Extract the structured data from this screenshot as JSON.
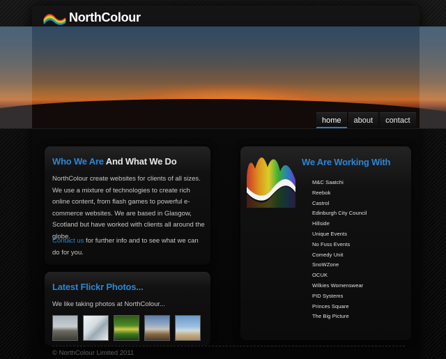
{
  "header": {
    "logo_text": "NorthColour",
    "logo_icon": "rainbow-wave-icon"
  },
  "nav": {
    "tabs": [
      {
        "label": "home",
        "active": true
      },
      {
        "label": "about",
        "active": false
      },
      {
        "label": "contact",
        "active": false
      }
    ]
  },
  "who": {
    "heading_blue": "Who We Are",
    "heading_white": "And What We Do",
    "paragraph": "NorthColour create websites for clients of all sizes. We use a mixture of technologies to create rich online content, from flash games to powerful e-commerce websites. We are based in Glasgow, Scotland but have worked with clients all around the globe.",
    "contact_link": "Contact us",
    "contact_rest": " for further info and to see what we can do for you."
  },
  "flickr": {
    "heading": "Latest Flickr Photos...",
    "text": "We like taking photos at NorthColour..."
  },
  "working": {
    "heading": "We Are Working With",
    "icon": "rainbow-wave-icon",
    "clients": [
      "M&C Saatchi",
      "Reebok",
      "Castrol",
      "Edinburgh City Council",
      "Hillside",
      "Unique Events",
      "No Fuss Events",
      "Comedy Unit",
      "SnoWZone",
      "OCUK",
      "Wilkies Womenswear",
      "PID Systems",
      "Princes Square",
      "The Big Picture"
    ]
  },
  "footer": {
    "copyright": "© NorthColour Limited 2011"
  },
  "colors": {
    "accent": "#2c86d6",
    "background": "#0c0c0c"
  }
}
